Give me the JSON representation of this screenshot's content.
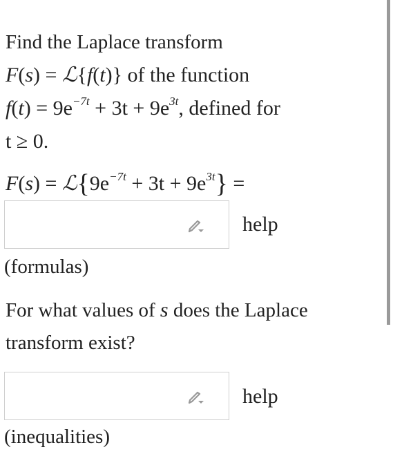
{
  "problem": {
    "line1": "Find the Laplace transform",
    "line2_of_function": "of the function",
    "line3_defined": ", defined for",
    "line4_domain": "t ≥ 0.",
    "question2_line1": "For what values of",
    "question2_var": "s",
    "question2_line1_end": "does the Laplace",
    "question2_line2": "transform exist?"
  },
  "math": {
    "F": "F",
    "s": "s",
    "f": "f",
    "t": "t",
    "eq": "=",
    "L": "ℒ",
    "lbrace": "{",
    "rbrace": "}",
    "lparen": "(",
    "rparen": ")",
    "coef1": "9e",
    "exp1": "−7t",
    "plus": "+",
    "term2": "3t",
    "coef3": "9e",
    "exp3": "3t"
  },
  "answers": [
    {
      "value": "",
      "help_label": "help",
      "hint": "(formulas)",
      "icon": "pencil-icon"
    },
    {
      "value": "",
      "help_label": "help",
      "hint": "(inequalities)",
      "icon": "pencil-icon"
    }
  ],
  "colors": {
    "text": "#222222",
    "box_border": "#cfcfcf",
    "scrollbar": "#9a9a9a",
    "icon": "#9a9a9a"
  }
}
